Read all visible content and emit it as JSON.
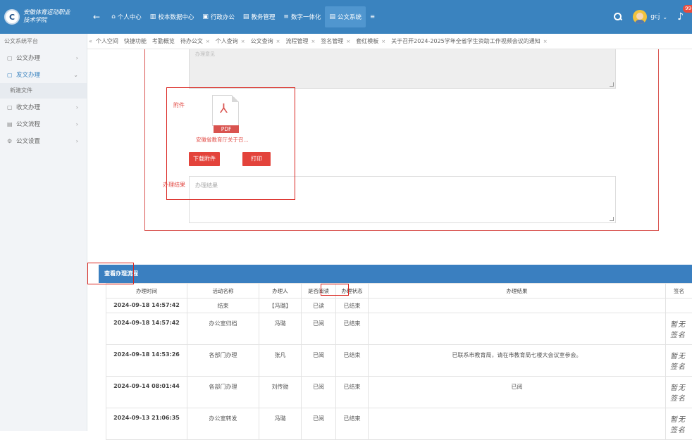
{
  "topbar": {
    "school_line1": "安徽体育运动职业",
    "school_line2": "技术学院",
    "back_label": "←",
    "nav": [
      {
        "icon": "⌂",
        "label": "个人中心"
      },
      {
        "icon": "▥",
        "label": "校本数据中心"
      },
      {
        "icon": "▣",
        "label": "行政办公"
      },
      {
        "icon": "▤",
        "label": "教务管理"
      },
      {
        "icon": "≡",
        "label": "数字一体化"
      },
      {
        "icon": "▤",
        "label": "公文系统"
      },
      {
        "icon": "",
        "label": "≡"
      }
    ],
    "username": "gcj",
    "caret": "⌄",
    "badge": "99+"
  },
  "sidebar": {
    "title": "公文系统平台",
    "items": [
      {
        "icon": "▢",
        "label": "公文办理",
        "arrow": "›"
      },
      {
        "icon": "▢",
        "label": "发文办理",
        "arrow": "⌄"
      },
      {
        "icon": "▢",
        "label": "收文办理",
        "arrow": "›"
      },
      {
        "icon": "▤",
        "label": "公文流程",
        "arrow": "›"
      },
      {
        "icon": "⚙",
        "label": "公文设置",
        "arrow": "›"
      }
    ],
    "sub_item": "新建文件"
  },
  "tabs": {
    "nav": "«",
    "items": [
      {
        "label": "个人空间",
        "closable": false
      },
      {
        "label": "快捷功能",
        "closable": false
      },
      {
        "label": "考勤概览",
        "closable": false
      },
      {
        "label": "待办公文",
        "closable": true
      },
      {
        "label": "个人查询",
        "closable": true
      },
      {
        "label": "公文查询",
        "closable": true
      },
      {
        "label": "流程管理",
        "closable": true
      },
      {
        "label": "签名管理",
        "closable": true
      },
      {
        "label": "套红模板",
        "closable": true
      },
      {
        "label": "关于召开2024-2025学年全省学生资助工作视频会议的通知",
        "closable": true
      }
    ],
    "close_glyph": "×"
  },
  "form": {
    "textarea_hint": "办理意见",
    "attachment_label": "附件",
    "pdf_tag": "PDF",
    "file_name": "安徽省教育厅关于召...",
    "download_button": "下载附件",
    "print_button": "打印",
    "result_label": "办理结果",
    "result_placeholder": "办理结果"
  },
  "flow": {
    "title": "查看办理流程",
    "columns": [
      "办理时间",
      "活动名称",
      "办理人",
      "是否阅读",
      "办理状态",
      "办理结果",
      "签名"
    ],
    "rows": [
      {
        "time": "2024-09-18 14:57:42",
        "activity": "结束",
        "handler": "【冯璐】",
        "read": "已读",
        "status": "已结束",
        "result": "",
        "signature": ""
      },
      {
        "time": "2024-09-18 14:57:42",
        "activity": "办公室归档",
        "handler": "冯璐",
        "read": "已阅",
        "status": "已结束",
        "result": "",
        "signature": "暂无签名"
      },
      {
        "time": "2024-09-18 14:53:26",
        "activity": "各部门办理",
        "handler": "张凡",
        "read": "已阅",
        "status": "已结束",
        "result": "已联系市教育局，请在市教育局七楼大会议室参会。",
        "signature": "暂无签名"
      },
      {
        "time": "2024-09-14 08:01:44",
        "activity": "各部门办理",
        "handler": "刘传勋",
        "read": "已阅",
        "status": "已结束",
        "result": "已阅",
        "signature": "暂无签名"
      },
      {
        "time": "2024-09-13 21:06:35",
        "activity": "办公室转发",
        "handler": "冯璐",
        "read": "已阅",
        "status": "已结束",
        "result": "",
        "signature": "暂无签名"
      }
    ]
  },
  "colors": {
    "topbar": "#3a83bf",
    "accent_red": "#e3433b",
    "flow_header": "#3a7fc0"
  }
}
